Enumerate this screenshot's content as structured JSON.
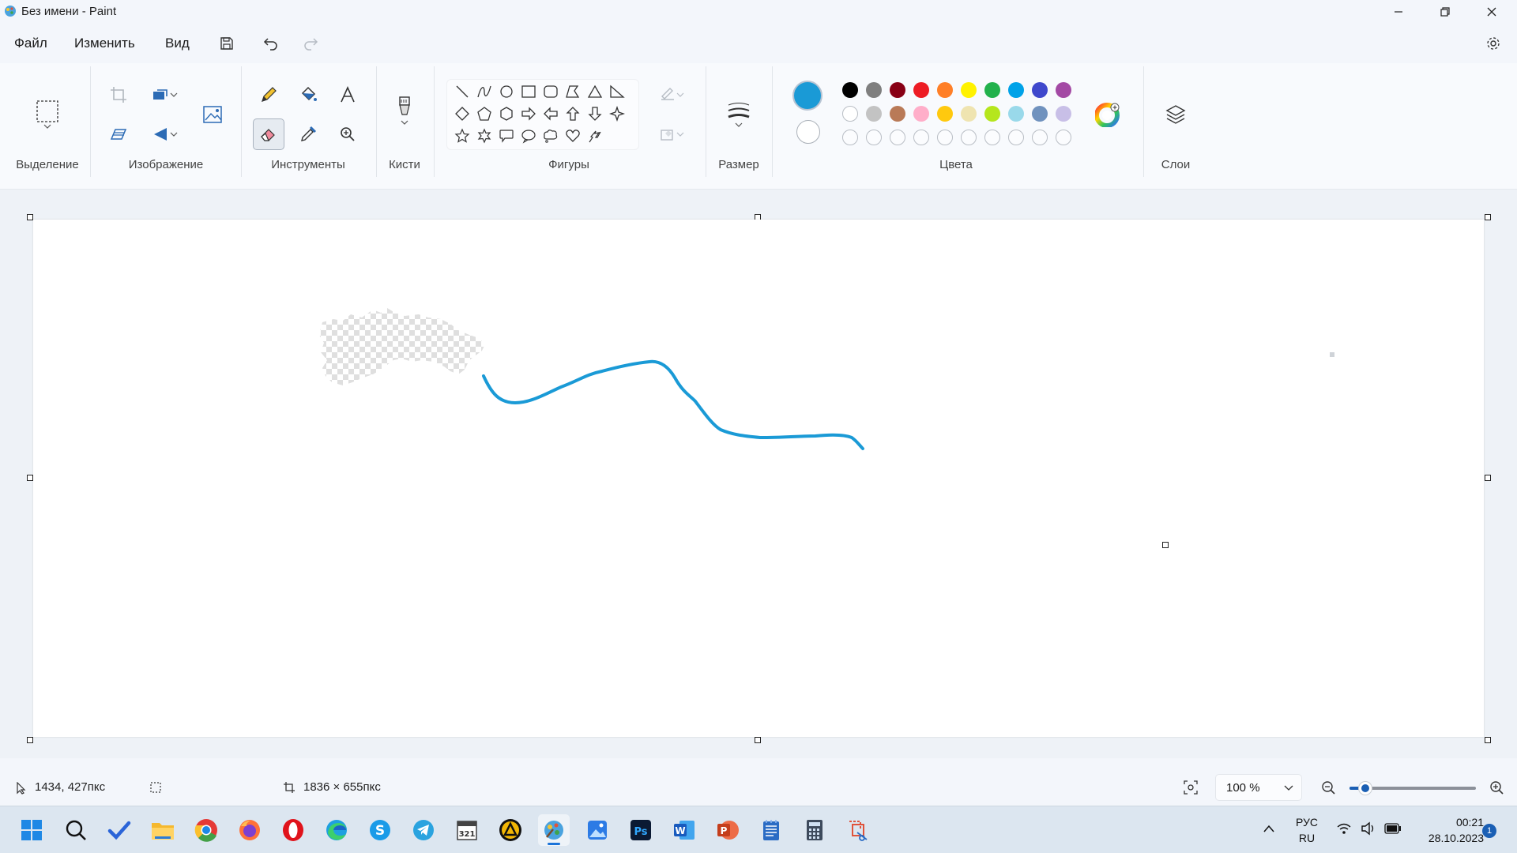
{
  "window": {
    "title": "Без имени - Paint"
  },
  "menu": {
    "file": "Файл",
    "edit": "Изменить",
    "view": "Вид"
  },
  "ribbon": {
    "groups": {
      "selection": "Выделение",
      "image": "Изображение",
      "tools": "Инструменты",
      "brushes": "Кисти",
      "shapes": "Фигуры",
      "size": "Размер",
      "colors": "Цвета",
      "layers": "Слои"
    },
    "tools": [
      "pencil-icon",
      "fill-bucket-icon",
      "text-icon",
      "eraser-icon",
      "color-picker-icon",
      "magnifier-icon"
    ],
    "active_tool": "eraser",
    "shapes": [
      "line",
      "curve",
      "oval",
      "rectangle",
      "rounded-rectangle",
      "polygon",
      "triangle",
      "right-triangle",
      "diamond",
      "pentagon",
      "hexagon",
      "right-arrow",
      "left-arrow",
      "up-arrow",
      "down-arrow",
      "four-point-star",
      "five-point-star",
      "six-point-star",
      "rounded-callout",
      "oval-callout",
      "cloud-callout",
      "heart",
      "lightning"
    ],
    "primary_color": "#1a9ad6",
    "secondary_color": "#ffffff",
    "palette_row1": [
      "#000000",
      "#7f7f7f",
      "#880015",
      "#ed1c24",
      "#ff7f27",
      "#fff200",
      "#22b14c",
      "#00a2e8",
      "#3f48cc",
      "#a349a4"
    ],
    "palette_row2": [
      "#ffffff",
      "#c3c3c3",
      "#b97a57",
      "#ffaec9",
      "#ffc90e",
      "#efe4b0",
      "#b5e61d",
      "#99d9ea",
      "#7092be",
      "#c8bfe7"
    ],
    "palette_row3_empty": 10
  },
  "canvas": {
    "stroke_color": "#1a9ad6"
  },
  "status": {
    "cursor_pos": "1434, 427пкс",
    "canvas_size": "1836 × 655пкс",
    "zoom": "100 %"
  },
  "taskbar": {
    "apps": [
      "windows-start-icon",
      "search-icon",
      "todo-icon",
      "file-explorer-icon",
      "chrome-icon",
      "firefox-icon",
      "opera-icon",
      "edge-icon",
      "skype-icon",
      "telegram-icon",
      "calendar-app-icon",
      "triangle-app-icon",
      "paint-icon",
      "photos-icon",
      "photoshop-icon",
      "word-icon",
      "powerpoint-icon",
      "notepad-icon",
      "calculator-icon",
      "snipping-tool-icon"
    ],
    "lang_top": "РУС",
    "lang_bottom": "RU",
    "time": "00:21",
    "date": "28.10.2023",
    "notification_count": "1"
  }
}
